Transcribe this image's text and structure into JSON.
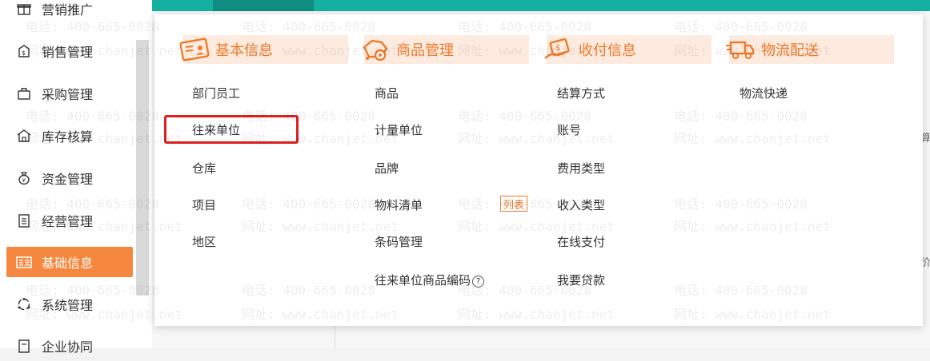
{
  "sidebar": {
    "items": [
      {
        "label": "营销推广",
        "icon": "gift-icon",
        "active": false
      },
      {
        "label": "销售管理",
        "icon": "tag-icon",
        "active": false
      },
      {
        "label": "采购管理",
        "icon": "shopping-bag-icon",
        "active": false
      },
      {
        "label": "库存核算",
        "icon": "warehouse-icon",
        "active": false
      },
      {
        "label": "资金管理",
        "icon": "money-bag-icon",
        "active": false
      },
      {
        "label": "经营管理",
        "icon": "clipboard-icon",
        "active": false
      },
      {
        "label": "基础信息",
        "icon": "id-card-icon",
        "active": true
      },
      {
        "label": "系统管理",
        "icon": "circle-dots-icon",
        "active": false
      },
      {
        "label": "企业协同",
        "icon": "document-icon",
        "active": false
      }
    ]
  },
  "menu": {
    "categories": [
      {
        "title": "基本信息",
        "icon": "id-card-icon",
        "items": [
          "部门员工",
          "往来单位",
          "仓库",
          "项目",
          "地区"
        ]
      },
      {
        "title": "商品管理",
        "icon": "box-gear-icon",
        "items": [
          "商品",
          "计量单位",
          "品牌",
          "物料清单",
          "条码管理",
          "往来单位商品编码"
        ]
      },
      {
        "title": "收付信息",
        "icon": "payment-hand-icon",
        "items": [
          "结算方式",
          "账号",
          "费用类型",
          "收入类型",
          "在线支付",
          "我要贷款"
        ]
      },
      {
        "title": "物流配送",
        "icon": "truck-icon",
        "items": [
          "物流快递"
        ]
      }
    ],
    "badge_label": "列表",
    "help_glyph": "?"
  },
  "watermark": {
    "phone": "电话: 400-665-0028",
    "site": "网址: www.chanjet.net"
  },
  "background": {
    "frag1": "算",
    "frag2": "价"
  },
  "colors": {
    "accent": "#f07a2a",
    "topbar": "#14b1a0",
    "highlight": "#e02020"
  }
}
